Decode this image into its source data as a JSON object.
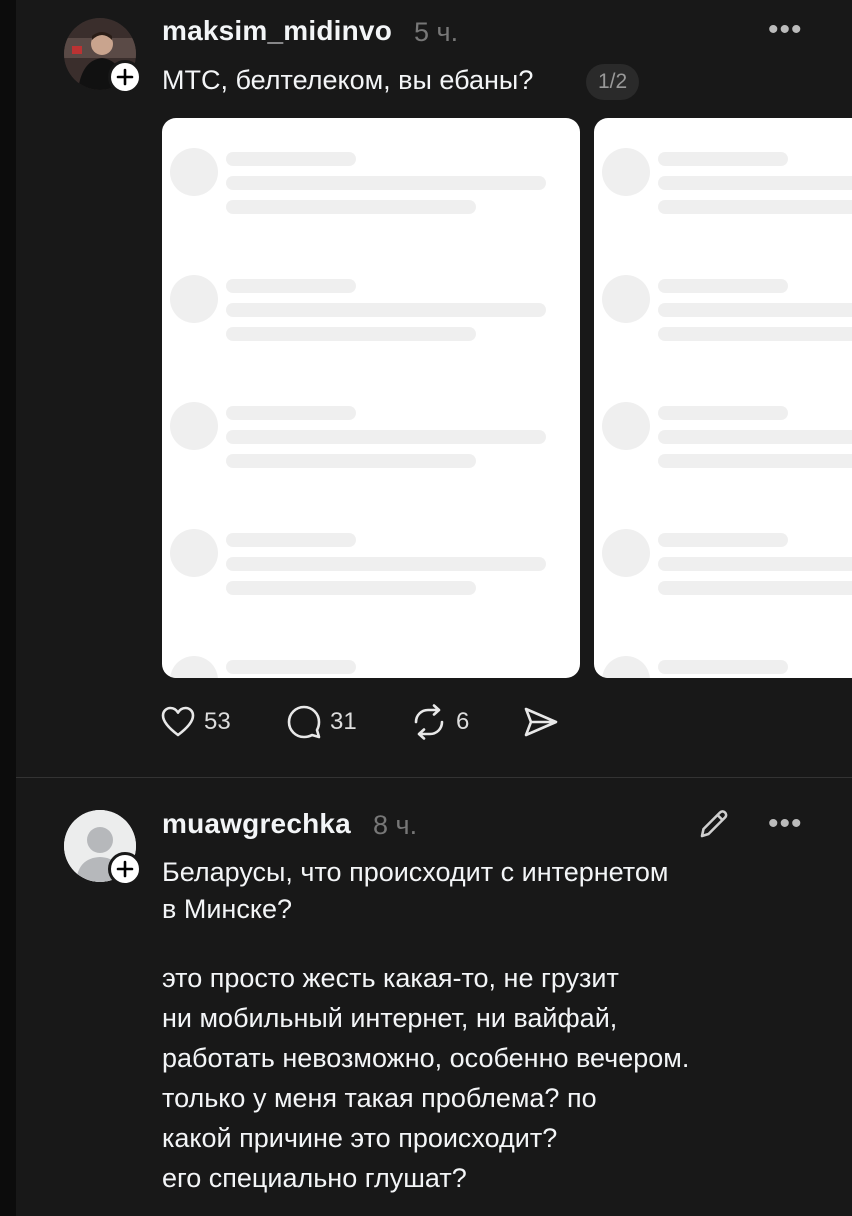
{
  "post1": {
    "username": "maksim_midinvo",
    "time": "5 ч.",
    "more": "•••",
    "text": "МТС, белтелеком, вы ебаны?",
    "pager": "1/2",
    "actions": {
      "likes": "53",
      "comments": "31",
      "reposts": "6"
    }
  },
  "post2": {
    "username": "muawgrechka",
    "time": "8 ч.",
    "more": "•••",
    "title_lines": [
      "Беларусы, что происходит с интернетом",
      "в Минске?"
    ],
    "body_lines": [
      "это просто жесть какая-то, не грузит",
      "ни мобильный интернет, ни вайфай,",
      "работать невозможно, особенно вечером.",
      "только у меня такая проблема? по",
      "какой причине это происходит?",
      "его специально глушат?"
    ]
  },
  "icons": {
    "plus": "plus-icon",
    "heart": "heart-icon",
    "comment": "comment-icon",
    "repost": "repost-icon",
    "share": "send-icon",
    "edit": "pencil-icon"
  },
  "colors": {
    "background": "#181818",
    "text": "#f3f5f7",
    "muted": "#777777",
    "card": "#ffffff"
  }
}
